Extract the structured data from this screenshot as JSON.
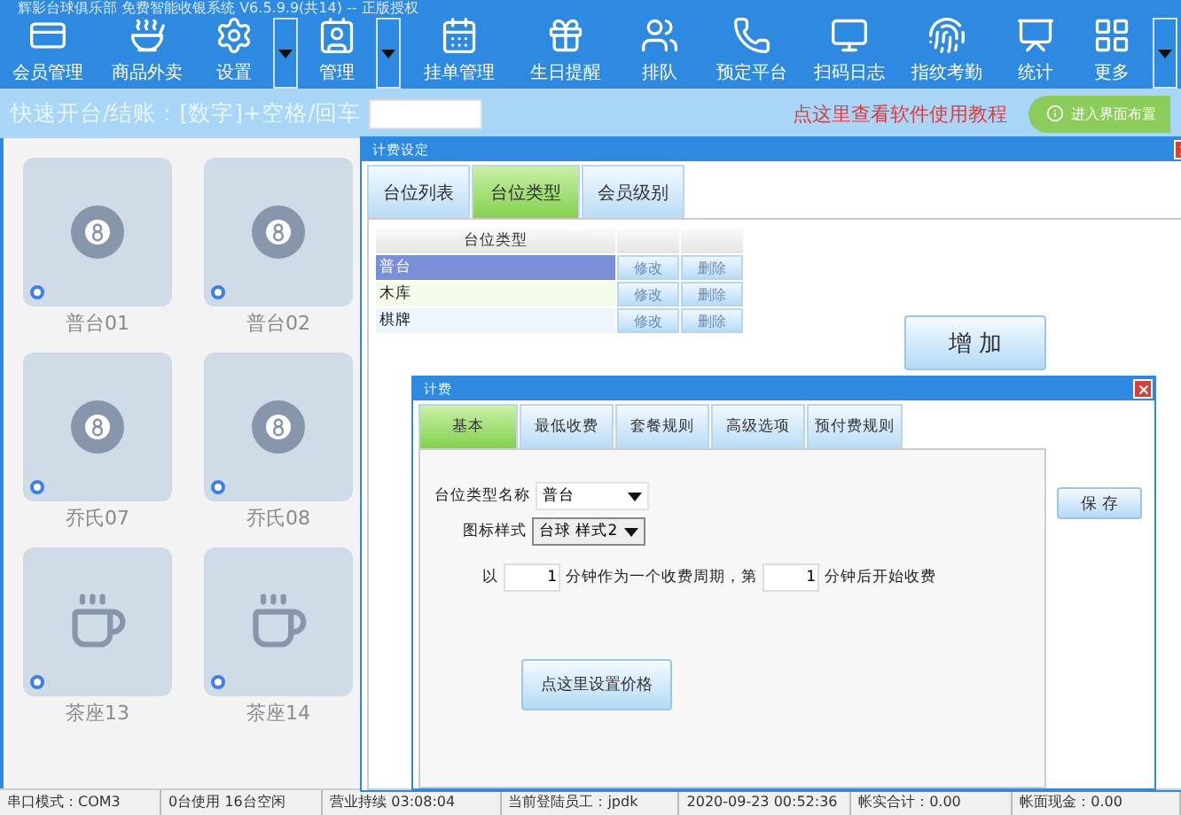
{
  "window": {
    "title": "辉影台球俱乐部 免费智能收银系统 V6.5.9.9(共14) -- 正版授权"
  },
  "toolbar": [
    {
      "label": "会员管理",
      "has_menu": false
    },
    {
      "label": "商品外卖",
      "has_menu": false
    },
    {
      "label": "设置",
      "has_menu": true
    },
    {
      "label": "管理",
      "has_menu": true
    },
    {
      "label": "挂单管理",
      "has_menu": false
    },
    {
      "label": "生日提醒",
      "has_menu": false
    },
    {
      "label": "排队",
      "has_menu": false
    },
    {
      "label": "预定平台",
      "has_menu": false
    },
    {
      "label": "扫码日志",
      "has_menu": false
    },
    {
      "label": "指纹考勤",
      "has_menu": false
    },
    {
      "label": "统计",
      "has_menu": false
    },
    {
      "label": "更多",
      "has_menu": true
    }
  ],
  "quick_bar": {
    "label": "快速开台/结账：[数字]+空格/回车",
    "tutorial_link": "点这里查看软件使用教程",
    "layout_button": "进入界面布置"
  },
  "tables": [
    {
      "name": "普台01",
      "kind": "billiards"
    },
    {
      "name": "普台02",
      "kind": "billiards"
    },
    {
      "name": "乔氏07",
      "kind": "billiards"
    },
    {
      "name": "乔氏08",
      "kind": "billiards"
    },
    {
      "name": "茶座13",
      "kind": "tea"
    },
    {
      "name": "茶座14",
      "kind": "tea"
    }
  ],
  "settings_dialog": {
    "title": "计费设定",
    "tabs": [
      {
        "label": "台位列表",
        "selected": false
      },
      {
        "label": "台位类型",
        "selected": true
      },
      {
        "label": "会员级别",
        "selected": false
      }
    ],
    "table": {
      "header": "台位类型",
      "rows": [
        {
          "name": "普台",
          "selected": true,
          "edit": "修改",
          "delete": "删除"
        },
        {
          "name": "木库",
          "selected": false,
          "edit": "修改",
          "delete": "删除"
        },
        {
          "name": "棋牌",
          "selected": false,
          "edit": "修改",
          "delete": "删除"
        }
      ]
    },
    "add_button": "增 加"
  },
  "billing_dialog": {
    "title": "计费",
    "tabs": [
      {
        "label": "基本",
        "selected": true
      },
      {
        "label": "最低收费",
        "selected": false
      },
      {
        "label": "套餐规则",
        "selected": false
      },
      {
        "label": "高级选项",
        "selected": false
      },
      {
        "label": "预付费规则",
        "selected": false
      }
    ],
    "type_name_label": "台位类型名称",
    "type_name_value": "普台",
    "icon_style_label": "图标样式",
    "icon_style_value": "台球 样式2",
    "period_prefix": "以",
    "period_value": "1",
    "period_middle": "分钟作为一个收费周期，第",
    "start_value": "1",
    "period_suffix": "分钟后开始收费",
    "price_button": "点这里设置价格",
    "save_button": "保 存"
  },
  "status_bar": [
    "串口模式：COM3",
    "0台使用 16台空闲",
    "营业持续 03:08:04",
    "当前登陆员工：jpdk",
    "2020-09-23 00:52:36",
    "帐实合计：0.00",
    "帐面现金：0.00"
  ]
}
